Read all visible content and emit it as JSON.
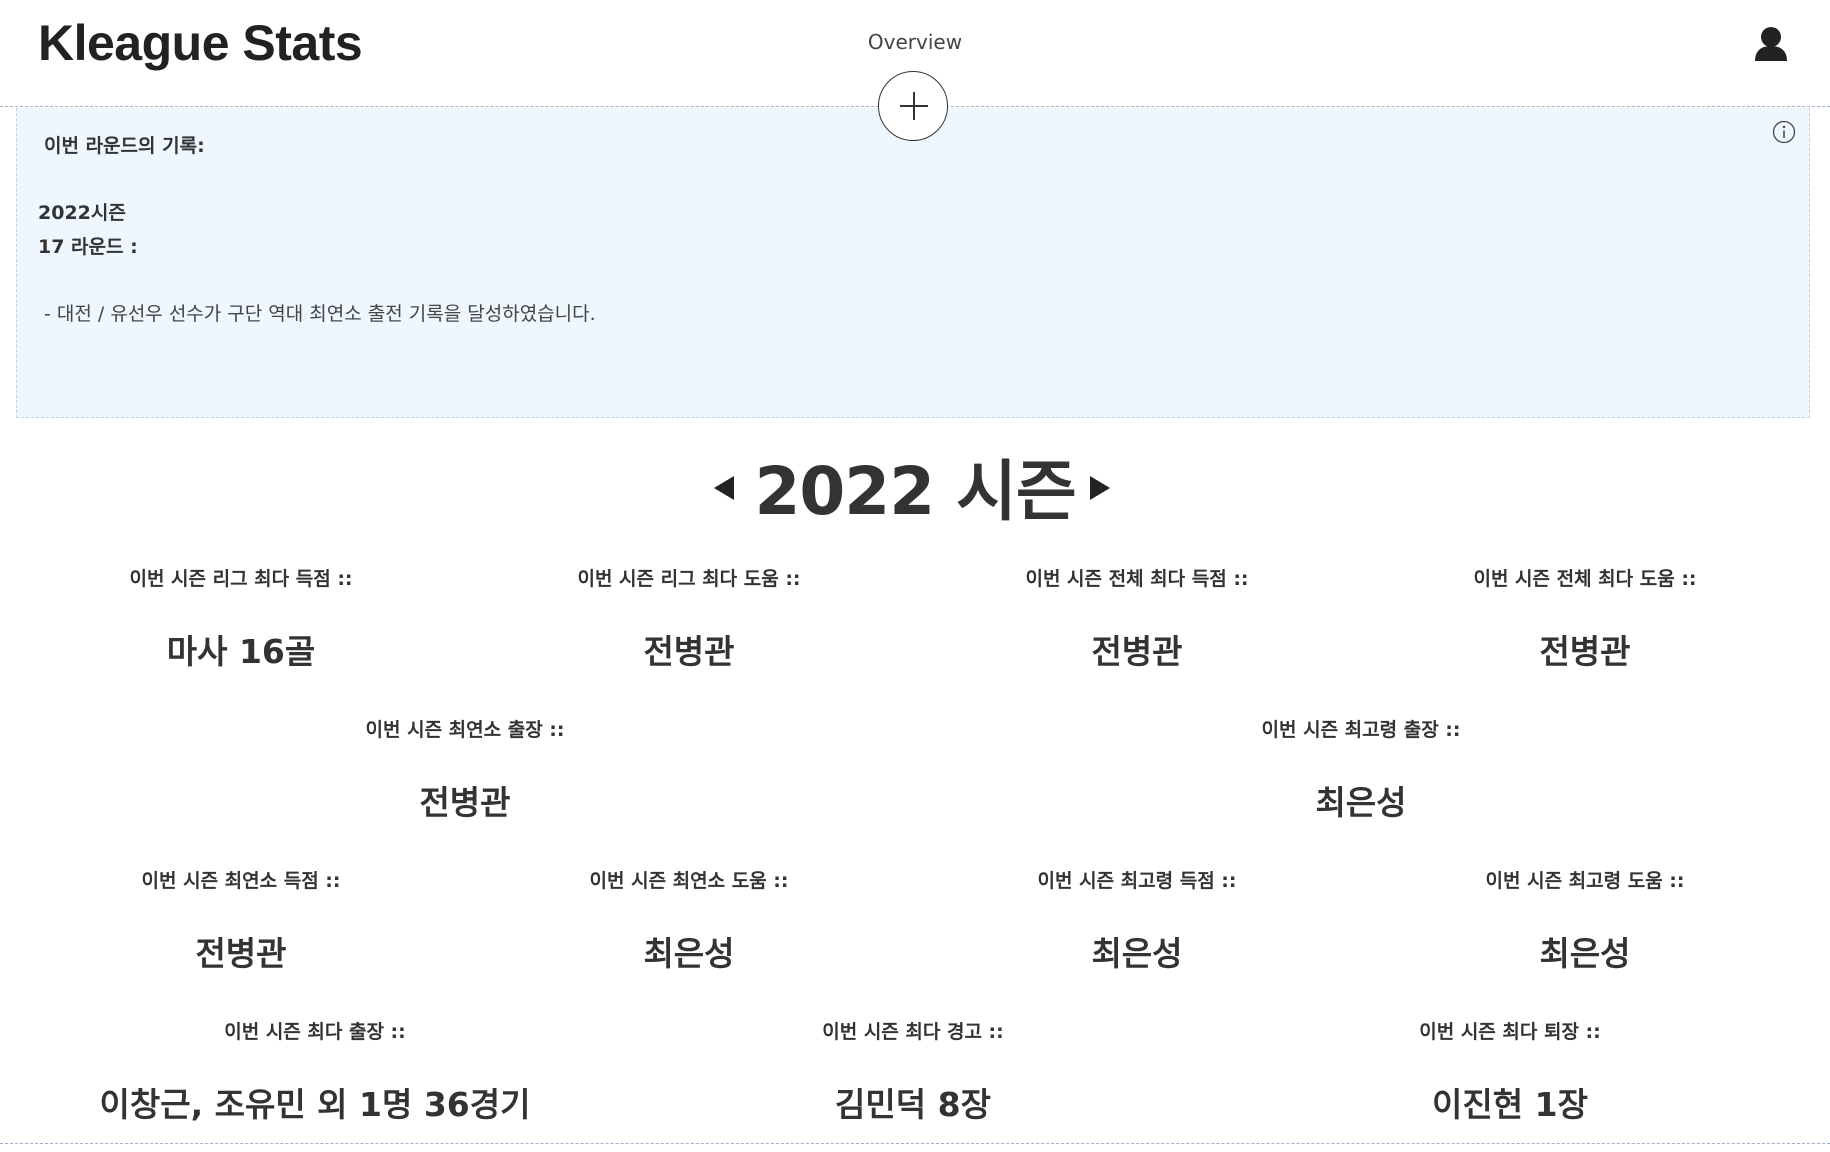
{
  "header": {
    "logo": "Kleague Stats",
    "nav_overview": "Overview",
    "user_icon": "user-icon",
    "add_icon": "plus-icon"
  },
  "info": {
    "icon": "info-icon",
    "heading": "이번 라운드의 기록:",
    "season": "2022시즌",
    "round": "17 라운드 :",
    "record": "- 대전 / 유선우 선수가 구단 역대 최연소 출전 기록을 달성하였습니다."
  },
  "season": {
    "title": "2022 시즌",
    "prev_icon": "triangle-left-icon",
    "next_icon": "triangle-right-icon"
  },
  "stats": {
    "league_top_scorer": {
      "label": "이번 시즌 리그 최다 득점 ::",
      "value": "마사 16골"
    },
    "league_top_assist": {
      "label": "이번 시즌 리그 최다 도움 ::",
      "value": "전병관"
    },
    "total_top_scorer": {
      "label": "이번 시즌 전체 최다 득점 ::",
      "value": "전병관"
    },
    "total_top_assist": {
      "label": "이번 시즌 전체 최다 도움 ::",
      "value": "전병관"
    },
    "youngest_appearance": {
      "label": "이번 시즌 최연소 출장 ::",
      "value": "전병관"
    },
    "oldest_appearance": {
      "label": "이번 시즌 최고령 출장 ::",
      "value": "최은성"
    },
    "youngest_scorer": {
      "label": "이번 시즌 최연소 득점 ::",
      "value": "전병관"
    },
    "youngest_assist": {
      "label": "이번 시즌 최연소 도움 ::",
      "value": "최은성"
    },
    "oldest_scorer": {
      "label": "이번 시즌 최고령 득점 ::",
      "value": "최은성"
    },
    "oldest_assist": {
      "label": "이번 시즌 최고령 도움 ::",
      "value": "최은성"
    },
    "most_appearances": {
      "label": "이번 시즌 최다 출장 ::",
      "value": "이창근, 조유민 외 1명 36경기"
    },
    "most_warnings": {
      "label": "이번 시즌 최다 경고 ::",
      "value": "김민덕 8장"
    },
    "most_sendoffs": {
      "label": "이번 시즌 최다 퇴장 ::",
      "value": "이진현 1장"
    }
  }
}
